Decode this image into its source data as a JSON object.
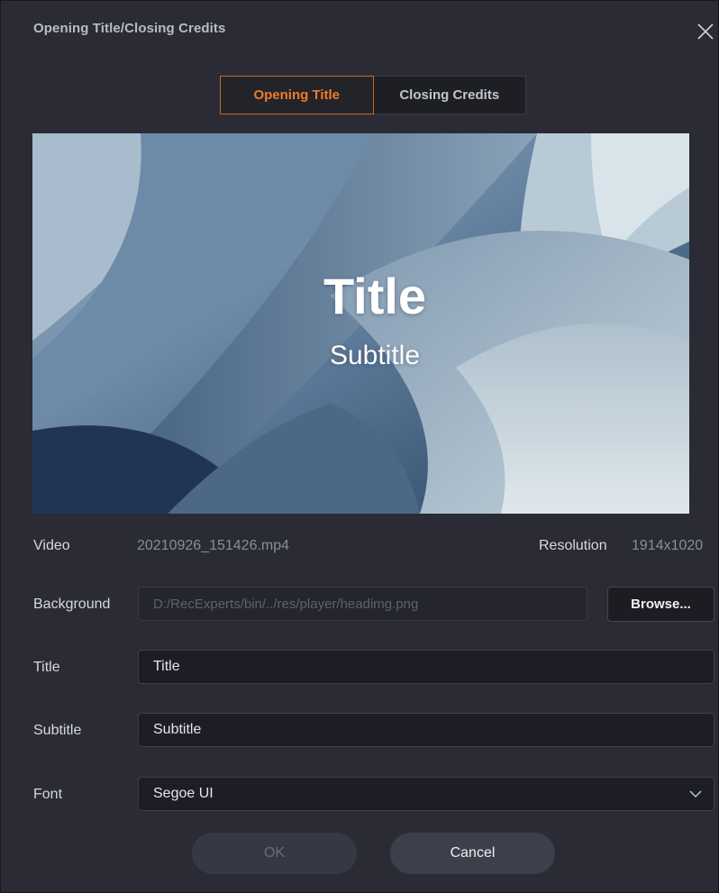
{
  "dialog": {
    "title": "Opening Title/Closing Credits"
  },
  "tabs": [
    {
      "label": "Opening Title",
      "active": true
    },
    {
      "label": "Closing Credits",
      "active": false
    }
  ],
  "preview": {
    "title": "Title",
    "subtitle": "Subtitle"
  },
  "info": {
    "video_label": "Video",
    "video_value": "20210926_151426.mp4",
    "resolution_label": "Resolution",
    "resolution_value": "1914x1020"
  },
  "form": {
    "background_label": "Background",
    "background_value": "D:/RecExperts/bin/../res/player/headimg.png",
    "browse_label": "Browse...",
    "title_label": "Title",
    "title_value": "Title",
    "subtitle_label": "Subtitle",
    "subtitle_value": "Subtitle",
    "font_label": "Font",
    "font_value": "Segoe UI"
  },
  "buttons": {
    "ok_label": "OK",
    "cancel_label": "Cancel"
  },
  "colors": {
    "accent": "#ee7d28",
    "dialog_bg": "#2a2b34"
  }
}
